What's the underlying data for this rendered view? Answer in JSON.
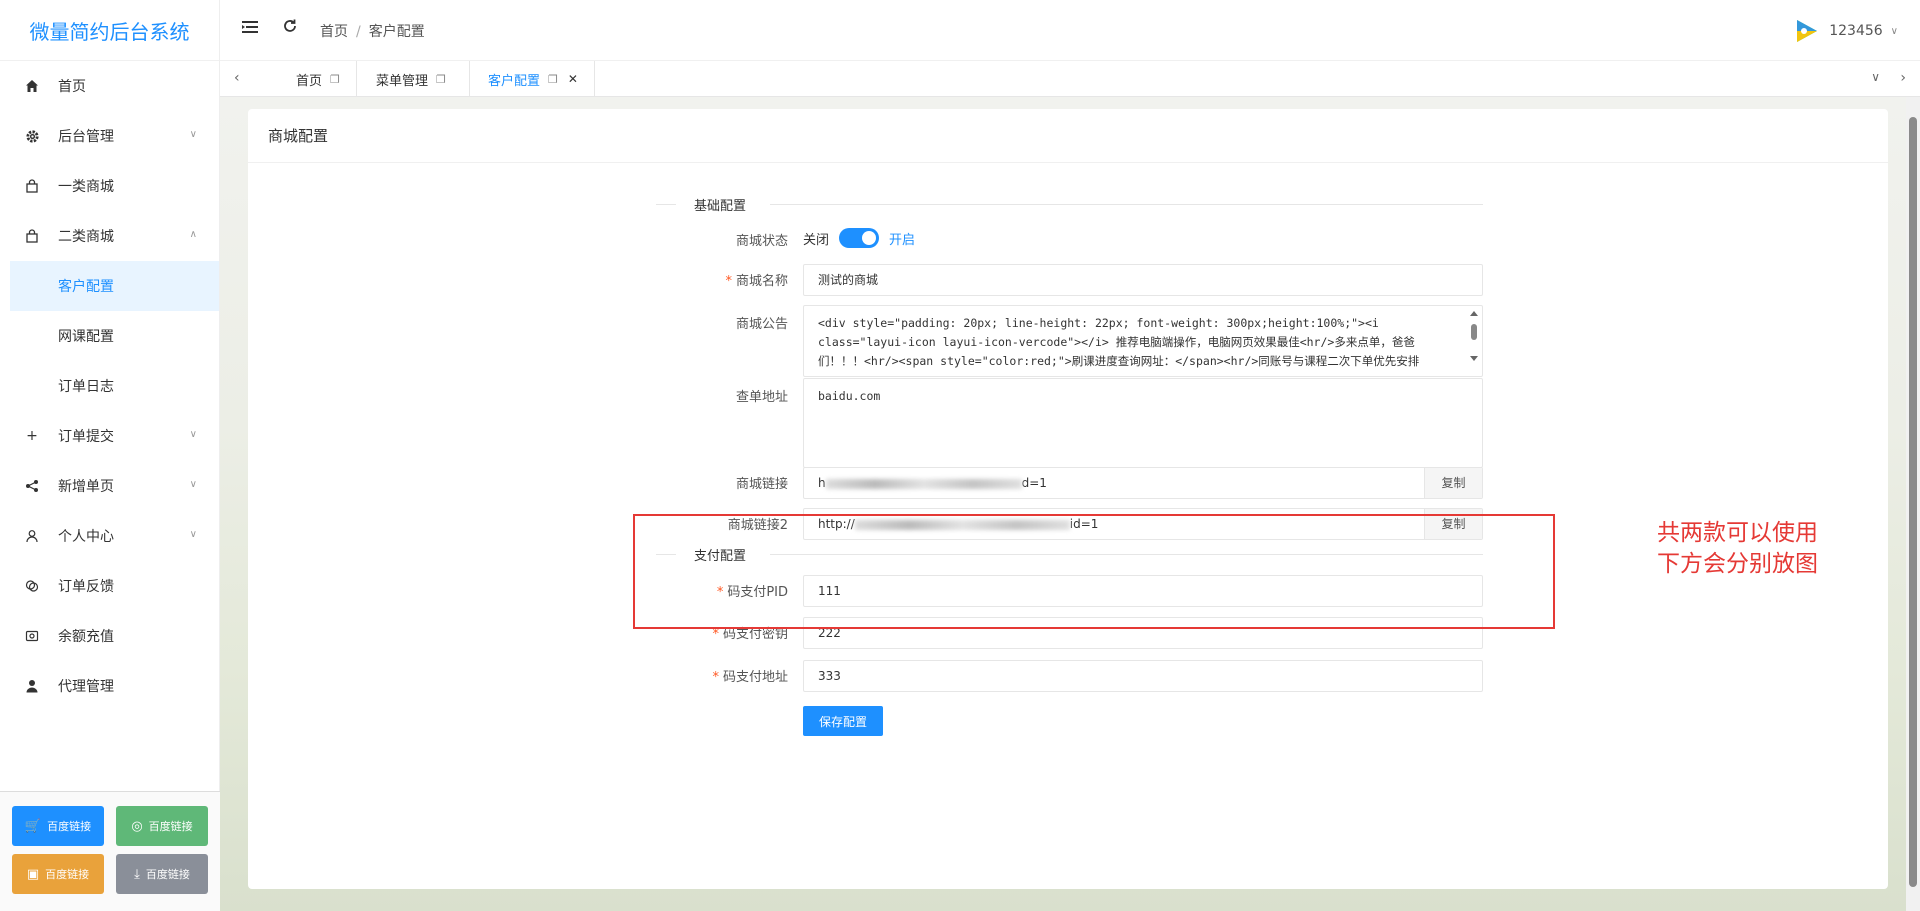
{
  "app": {
    "title": "微量简约后台系统"
  },
  "sidebar": {
    "items": [
      {
        "label": "首页",
        "icon": "home-icon"
      },
      {
        "label": "后台管理",
        "icon": "gear-icon",
        "has_children": true
      },
      {
        "label": "一类商城",
        "icon": "bag-icon"
      },
      {
        "label": "二类商城",
        "icon": "bag-icon",
        "has_children": true,
        "expanded": true
      },
      {
        "label": "订单提交",
        "icon": "plus-icon",
        "has_children": true
      },
      {
        "label": "新增单页",
        "icon": "share-icon",
        "has_children": true
      },
      {
        "label": "个人中心",
        "icon": "user-icon",
        "has_children": true
      },
      {
        "label": "订单反馈",
        "icon": "feedback-icon"
      },
      {
        "label": "余额充值",
        "icon": "wallet-icon"
      },
      {
        "label": "代理管理",
        "icon": "person-icon"
      }
    ],
    "subitems": [
      {
        "label": "客户配置",
        "active": true
      },
      {
        "label": "网课配置"
      },
      {
        "label": "订单日志"
      }
    ],
    "buttons": [
      {
        "label": "百度链接",
        "color": "#1E90FF",
        "icon": "cart-icon"
      },
      {
        "label": "百度链接",
        "color": "#5FB878",
        "icon": "medal-icon"
      },
      {
        "label": "百度链接",
        "color": "#E9A23B",
        "icon": "save-icon"
      },
      {
        "label": "百度链接",
        "color": "#8A8F99",
        "icon": "download-icon"
      }
    ]
  },
  "header": {
    "breadcrumb": [
      "首页",
      "客户配置"
    ],
    "username": "123456"
  },
  "tabs": [
    {
      "label": "首页"
    },
    {
      "label": "菜单管理"
    },
    {
      "label": "客户配置",
      "active": true
    }
  ],
  "card": {
    "title": "商城配置",
    "basic_section": "基础配置",
    "pay_section": "支付配置",
    "fields": {
      "status_label": "商城状态",
      "status_off": "关闭",
      "status_on": "开启",
      "status_value": true,
      "name_label": "商城名称",
      "name_value": "测试的商城",
      "notice_label": "商城公告",
      "notice_value": "<div style=\"padding: 20px; line-height: 22px; font-weight: 300px;height:100%;\"><i class=\"layui-icon layui-icon-vercode\"></i> 推荐电脑端操作，电脑网页效果最佳<hr/>多来点单，爸爸们！！！<hr/><span style=\"color:red;\">刷课进度查询网址：</span><hr/>同账号与课程二次下单优先安排",
      "query_label": "查单地址",
      "query_value": "baidu.com",
      "link_label": "商城链接",
      "link_prefix": "h",
      "link_suffix": "d=1",
      "link2_label": "商城链接2",
      "link2_prefix": "http://",
      "link2_suffix": "id=1",
      "copy_label": "复制",
      "pid_label": "码支付PID",
      "pid_value": "111",
      "key_label": "码支付密钥",
      "key_value": "222",
      "addr_label": "码支付地址",
      "addr_value": "333",
      "save_label": "保存配置"
    }
  },
  "annotation": {
    "line1": "共两款可以使用",
    "line2": "下方会分别放图",
    "color": "#e53935"
  },
  "colors": {
    "accent": "#1E90FF",
    "required": "#ff5722"
  }
}
